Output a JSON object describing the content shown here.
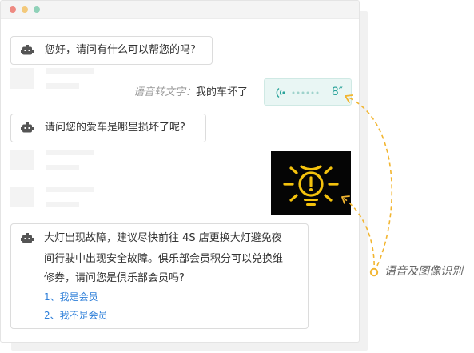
{
  "chat": {
    "messages": [
      {
        "role": "bot",
        "text": "您好，请问有什么可以帮您的吗?"
      },
      {
        "role": "user",
        "kind": "voice",
        "transcript_label": "语音转文字：",
        "transcript_text": "我的车坏了",
        "duration": "8″"
      },
      {
        "role": "bot",
        "text": "请问您的爱车是哪里损坏了呢?"
      },
      {
        "role": "user",
        "kind": "image",
        "content": "warning-light-icon"
      },
      {
        "role": "bot",
        "lines": [
          "大灯出现故障，建议尽快前往 4S 店更换大灯避免夜",
          "间行驶中出现安全故障。俱乐部会员积分可以兑换维",
          "修券，请问您是俱乐部会员吗?"
        ],
        "options": [
          "1、我是会员",
          "2、我不是会员"
        ]
      }
    ]
  },
  "annotation": {
    "text": "语音及图像识别"
  },
  "colors": {
    "accent_orange": "#f2b530",
    "voice_teal": "#2aa39a",
    "link_blue": "#2e7fd9",
    "warning_yellow": "#f4c20d"
  },
  "icons": {
    "bot": "robot-icon",
    "voice": "sound-wave-icon",
    "image": "warning-light-icon"
  }
}
